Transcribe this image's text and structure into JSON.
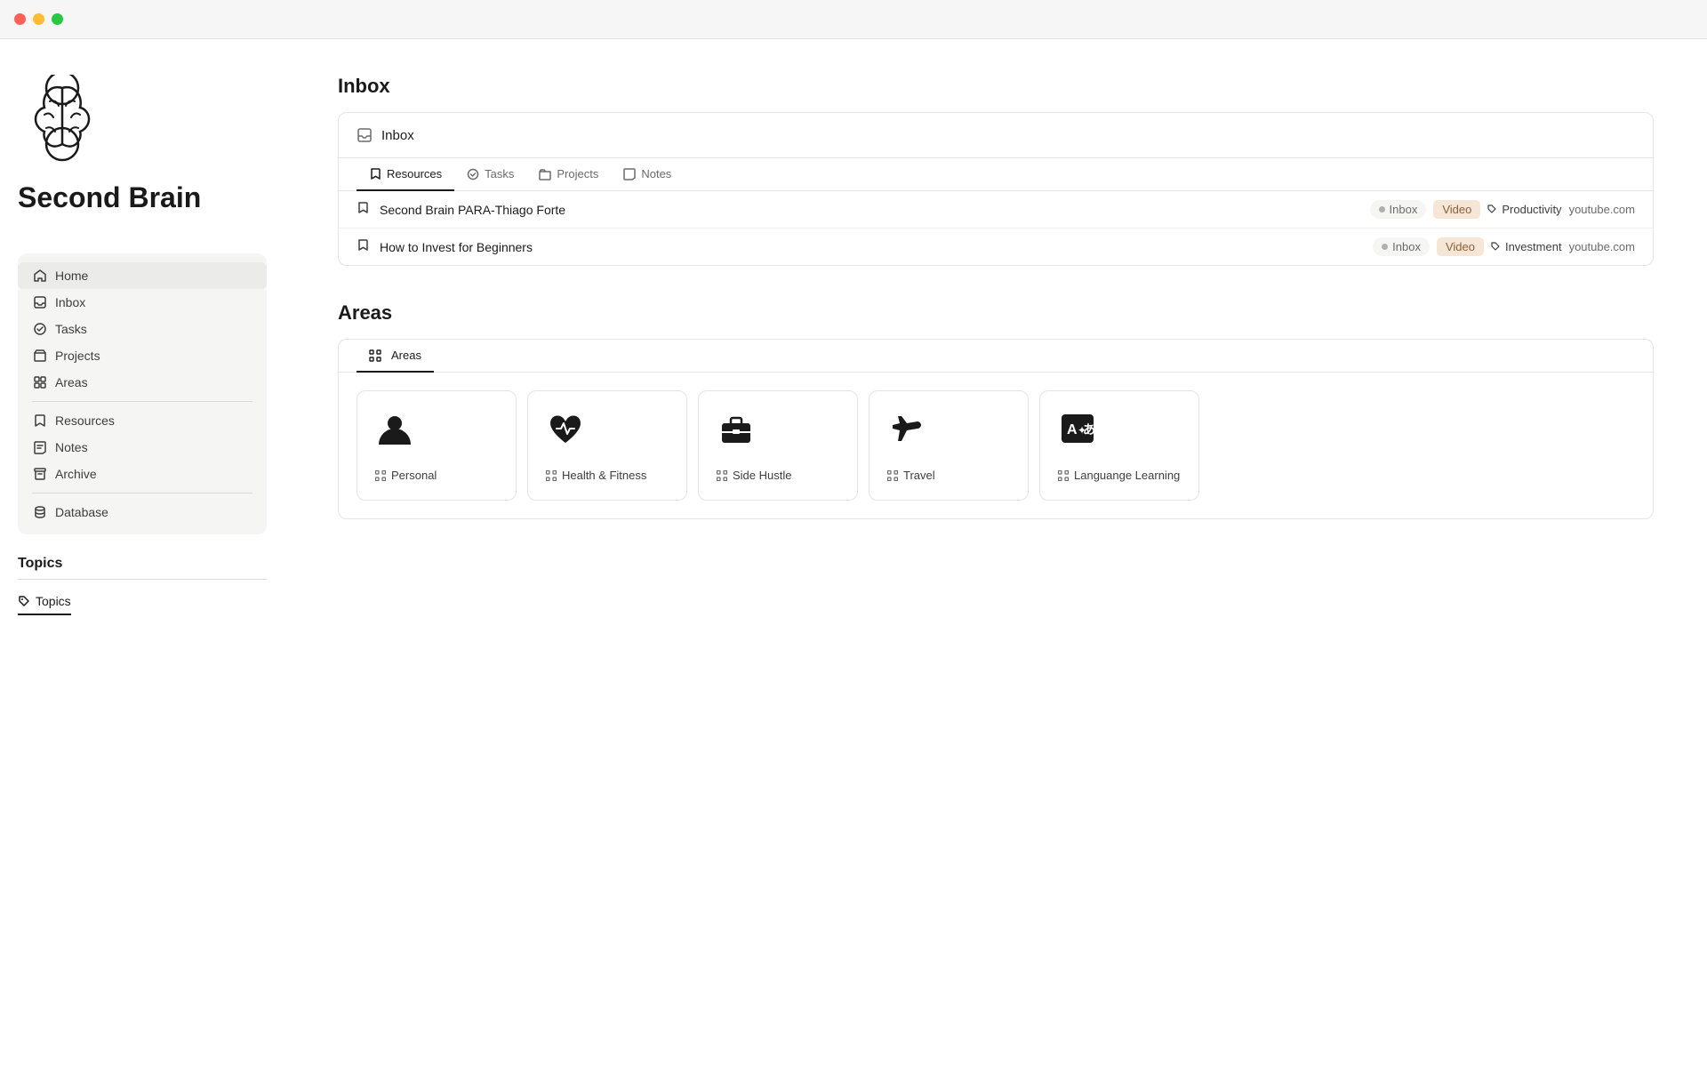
{
  "titlebar": {
    "buttons": [
      "red",
      "yellow",
      "green"
    ]
  },
  "app": {
    "title": "Second Brain"
  },
  "sidebar": {
    "main_items": [
      {
        "id": "home",
        "label": "Home",
        "icon": "home"
      },
      {
        "id": "inbox",
        "label": "Inbox",
        "icon": "inbox"
      },
      {
        "id": "tasks",
        "label": "Tasks",
        "icon": "tasks"
      },
      {
        "id": "projects",
        "label": "Projects",
        "icon": "projects"
      },
      {
        "id": "areas",
        "label": "Areas",
        "icon": "areas"
      }
    ],
    "secondary_items": [
      {
        "id": "resources",
        "label": "Resources",
        "icon": "bookmark"
      },
      {
        "id": "notes",
        "label": "Notes",
        "icon": "notes"
      },
      {
        "id": "archive",
        "label": "Archive",
        "icon": "archive"
      }
    ],
    "tertiary_items": [
      {
        "id": "database",
        "label": "Database",
        "icon": "database"
      }
    ]
  },
  "topics": {
    "heading": "Topics",
    "tab_label": "Topics",
    "tab_icon": "tag"
  },
  "inbox_section": {
    "heading": "Inbox",
    "card_header_icon": "inbox",
    "card_header_label": "Inbox",
    "tabs": [
      {
        "id": "resources",
        "label": "Resources",
        "icon": "bookmark",
        "active": true
      },
      {
        "id": "tasks",
        "label": "Tasks",
        "icon": "check"
      },
      {
        "id": "projects",
        "label": "Projects",
        "icon": "folder"
      },
      {
        "id": "notes",
        "label": "Notes",
        "icon": "note"
      }
    ],
    "rows": [
      {
        "title": "Second Brain PARA-Thiago Forte",
        "status": "Inbox",
        "type": "Video",
        "category": "Productivity",
        "source": "youtube.com"
      },
      {
        "title": "How to Invest for Beginners",
        "status": "Inbox",
        "type": "Video",
        "category": "Investment",
        "source": "youtube.com"
      }
    ]
  },
  "areas_section": {
    "heading": "Areas",
    "tab_label": "Areas",
    "tab_icon": "cmd",
    "cards": [
      {
        "id": "personal",
        "label": "Personal",
        "icon": "person"
      },
      {
        "id": "health",
        "label": "Health & Fitness",
        "icon": "heart-pulse"
      },
      {
        "id": "side-hustle",
        "label": "Side Hustle",
        "icon": "briefcase"
      },
      {
        "id": "travel",
        "label": "Travel",
        "icon": "airplane"
      },
      {
        "id": "language",
        "label": "Languange Learning",
        "icon": "translate"
      }
    ]
  },
  "colors": {
    "accent": "#1a1a1a",
    "sidebar_bg": "#f5f5f4",
    "tag_video_bg": "#f5e6d6",
    "tag_video_text": "#8b5e3c"
  }
}
